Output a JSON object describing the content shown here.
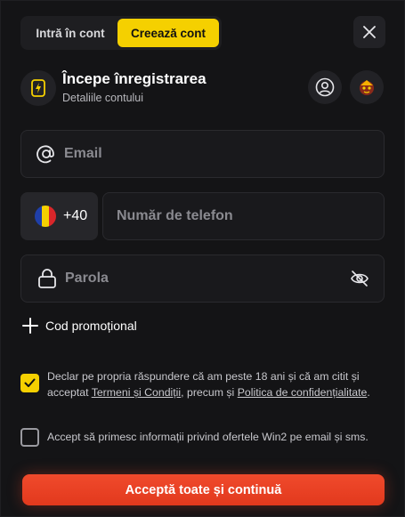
{
  "tabs": {
    "login": "Intră în cont",
    "register": "Creează cont"
  },
  "header": {
    "title": "Începe înregistrarea",
    "subtitle": "Detaliile contului"
  },
  "form": {
    "email_placeholder": "Email",
    "phone_prefix": "+40",
    "phone_placeholder": "Număr de telefon",
    "password_placeholder": "Parola",
    "promo_label": "Cod promoțional"
  },
  "consent": {
    "age_part1": "Declar pe propria răspundere că am peste 18 ani și că am citit și acceptat ",
    "terms_link": "Termeni și Condiții",
    "age_part2": ", precum și ",
    "privacy_link": "Politica de confidențialitate",
    "age_part3": ".",
    "age_checked": true,
    "marketing": "Accept să primesc informații privind ofertele Win2 pe email și sms.",
    "marketing_checked": false
  },
  "cta_label": "Acceptă toate și continuă",
  "colors": {
    "accent_yellow": "#f5d000",
    "cta_red": "#e8401f",
    "panel_bg": "#141416"
  },
  "icons": [
    "close-icon",
    "lightning-icon",
    "user-icon",
    "avatar-icon",
    "at-icon",
    "flag-icon",
    "lock-icon",
    "eye-off-icon",
    "plus-icon",
    "check-icon"
  ]
}
